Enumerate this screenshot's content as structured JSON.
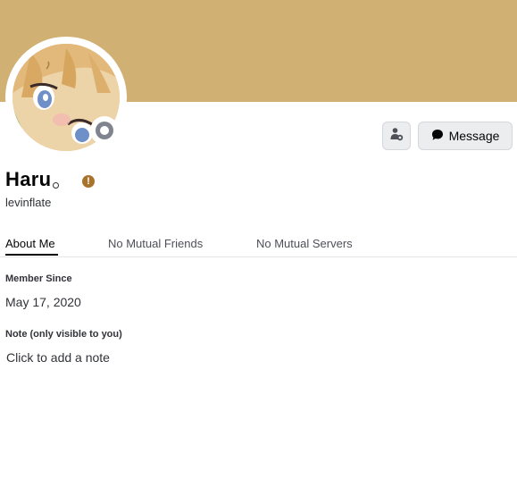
{
  "profile": {
    "display_name": "Haru",
    "username": "levinflate",
    "status": "offline",
    "badge_icon": "warning-icon",
    "colors": {
      "banner": "#d0b073",
      "badge": "#a8732d",
      "status": "#80848e"
    }
  },
  "actions": {
    "add_friend_icon": "add-friend-icon",
    "message_label": "Message",
    "message_icon": "chat-bubble-icon"
  },
  "tabs": [
    {
      "label": "About Me",
      "active": true
    },
    {
      "label": "No Mutual Friends",
      "active": false
    },
    {
      "label": "No Mutual Servers",
      "active": false
    }
  ],
  "about": {
    "member_since_label": "Member Since",
    "member_since_value": "May 17, 2020",
    "note_label": "Note (only visible to you)",
    "note_placeholder": "Click to add a note"
  }
}
